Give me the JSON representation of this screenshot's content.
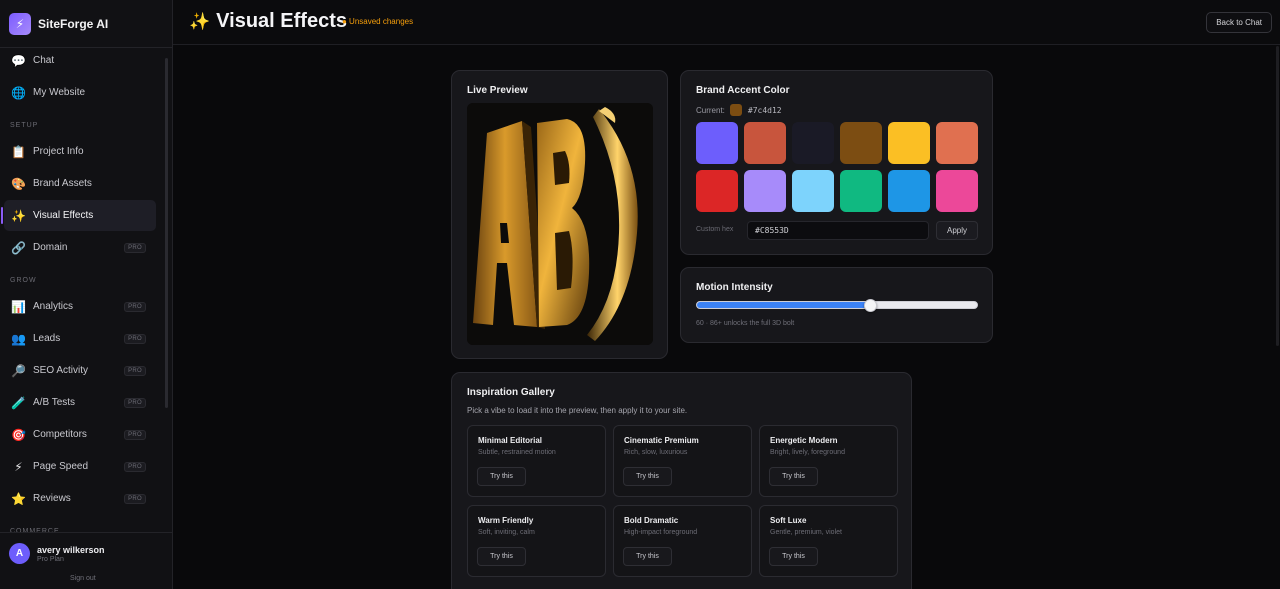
{
  "app": {
    "name": "SiteForge AI",
    "logo_icon": "lightning-icon"
  },
  "sidebar": {
    "items": [
      {
        "label": "Chat",
        "icon": "💬"
      },
      {
        "label": "My Website",
        "icon": "🌐"
      }
    ],
    "setup_heading": "SETUP",
    "setup_items": [
      {
        "label": "Project Info",
        "icon": "📋",
        "pro": ""
      },
      {
        "label": "Brand Assets",
        "icon": "🎨",
        "pro": ""
      },
      {
        "label": "Visual Effects",
        "icon": "✨",
        "pro": "",
        "active": true
      },
      {
        "label": "Domain",
        "icon": "🔗",
        "pro": "PRO"
      }
    ],
    "grow_heading": "GROW",
    "grow_items": [
      {
        "label": "Analytics",
        "icon": "📊",
        "pro": "PRO"
      },
      {
        "label": "Leads",
        "icon": "👥",
        "pro": "PRO"
      },
      {
        "label": "SEO Activity",
        "icon": "🔎",
        "pro": "PRO"
      },
      {
        "label": "A/B Tests",
        "icon": "🧪",
        "pro": "PRO"
      },
      {
        "label": "Competitors",
        "icon": "🎯",
        "pro": "PRO"
      },
      {
        "label": "Page Speed",
        "icon": "⚡",
        "pro": "PRO"
      },
      {
        "label": "Reviews",
        "icon": "⭐",
        "pro": "PRO"
      }
    ],
    "commerce_heading": "COMMERCE"
  },
  "user": {
    "initial": "A",
    "name": "avery wilkerson",
    "plan": "Pro Plan",
    "signout": "Sign out"
  },
  "header": {
    "icon": "✨",
    "title": "Visual Effects",
    "unsaved": "● Unsaved changes",
    "back_label": "Back to Chat"
  },
  "preview": {
    "title": "Live Preview",
    "letters": "AB"
  },
  "accent": {
    "title": "Brand Accent Color",
    "current_label": "Current:",
    "current_hex": "#7c4d12",
    "current_color": "#7c4d12",
    "swatches": [
      "#6d5efc",
      "#c8553d",
      "#1a1a26",
      "#7c4d12",
      "#fbbf24",
      "#e07050",
      "#dc2626",
      "#a78bfa",
      "#7dd3fc",
      "#10b981",
      "#1e96e6",
      "#ec4899"
    ],
    "custom_label": "Custom hex",
    "custom_value": "#C8553D",
    "apply_label": "Apply"
  },
  "motion": {
    "title": "Motion Intensity",
    "value": 60,
    "note": "60 · 86+ unlocks the full 3D bolt"
  },
  "gallery": {
    "title": "Inspiration Gallery",
    "subtitle": "Pick a vibe to load it into the preview, then apply it to your site.",
    "try_label": "Try this",
    "vibes": [
      {
        "name": "Minimal Editorial",
        "desc": "Subtle, restrained motion"
      },
      {
        "name": "Cinematic Premium",
        "desc": "Rich, slow, luxurious"
      },
      {
        "name": "Energetic Modern",
        "desc": "Bright, lively, foreground"
      },
      {
        "name": "Warm Friendly",
        "desc": "Soft, inviting, calm"
      },
      {
        "name": "Bold Dramatic",
        "desc": "High-impact foreground"
      },
      {
        "name": "Soft Luxe",
        "desc": "Gentle, premium, violet"
      }
    ]
  }
}
